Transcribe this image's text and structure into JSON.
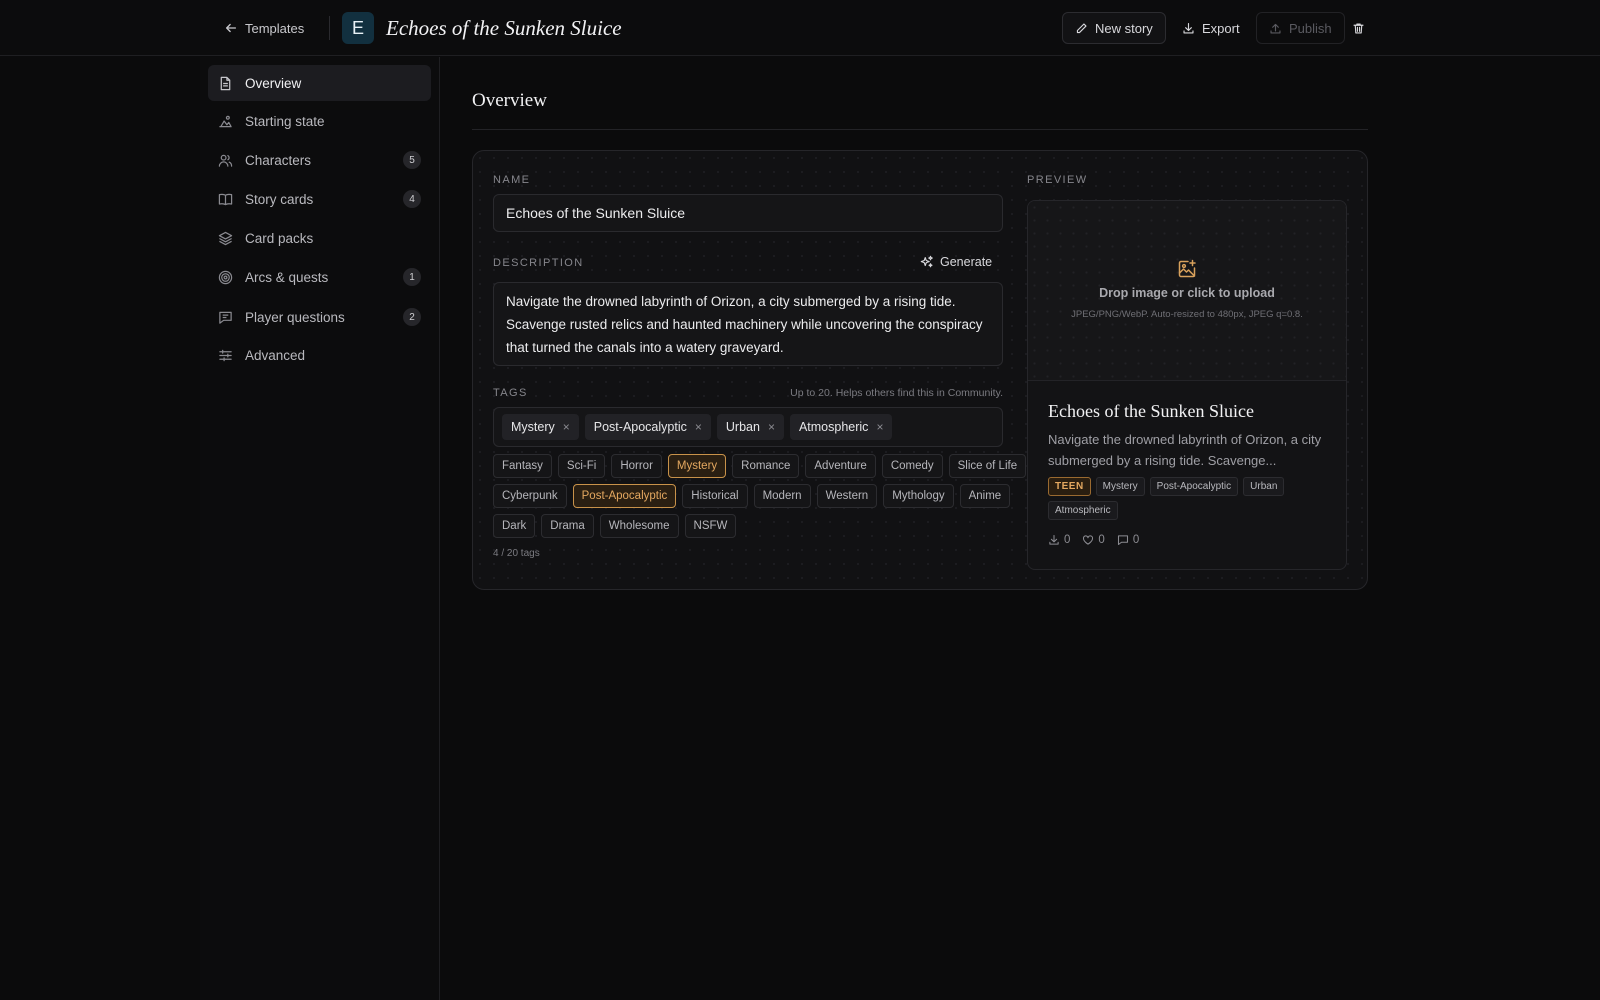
{
  "header": {
    "back_label": "Templates",
    "avatar_letter": "E",
    "story_title": "Echoes of the Sunken Sluice",
    "new_story_label": "New story",
    "export_label": "Export",
    "publish_label": "Publish"
  },
  "sidebar": {
    "items": [
      {
        "label": "Overview",
        "icon": "document-icon",
        "badge": ""
      },
      {
        "label": "Starting state",
        "icon": "landscape-icon",
        "badge": ""
      },
      {
        "label": "Characters",
        "icon": "users-icon",
        "badge": "5"
      },
      {
        "label": "Story cards",
        "icon": "book-icon",
        "badge": "4"
      },
      {
        "label": "Card packs",
        "icon": "layers-icon",
        "badge": ""
      },
      {
        "label": "Arcs & quests",
        "icon": "target-icon",
        "badge": "1"
      },
      {
        "label": "Player questions",
        "icon": "message-icon",
        "badge": "2"
      },
      {
        "label": "Advanced",
        "icon": "sliders-icon",
        "badge": ""
      }
    ]
  },
  "main": {
    "title": "Overview",
    "name_label": "NAME",
    "name_value": "Echoes of the Sunken Sluice",
    "description_label": "DESCRIPTION",
    "generate_label": "Generate",
    "description_value": "Navigate the drowned labyrinth of Orizon, a city submerged by a rising tide. Scavenge rusted relics and haunted machinery while uncovering the conspiracy that turned the canals into a watery graveyard.",
    "tags_label": "TAGS",
    "tags_hint": "Up to 20. Helps others find this in Community.",
    "selected_tags": [
      "Mystery",
      "Post-Apocalyptic",
      "Urban",
      "Atmospheric"
    ],
    "remove_glyph": "×",
    "suggestion_rows": [
      [
        {
          "label": "Fantasy",
          "on": false
        },
        {
          "label": "Sci-Fi",
          "on": false
        },
        {
          "label": "Horror",
          "on": false
        },
        {
          "label": "Mystery",
          "on": true
        },
        {
          "label": "Romance",
          "on": false
        },
        {
          "label": "Adventure",
          "on": false
        },
        {
          "label": "Comedy",
          "on": false
        },
        {
          "label": "Slice of Life",
          "on": false
        }
      ],
      [
        {
          "label": "Cyberpunk",
          "on": false
        },
        {
          "label": "Post-Apocalyptic",
          "on": true
        },
        {
          "label": "Historical",
          "on": false
        },
        {
          "label": "Modern",
          "on": false
        },
        {
          "label": "Western",
          "on": false
        },
        {
          "label": "Mythology",
          "on": false
        },
        {
          "label": "Anime",
          "on": false
        }
      ],
      [
        {
          "label": "Dark",
          "on": false
        },
        {
          "label": "Drama",
          "on": false
        },
        {
          "label": "Wholesome",
          "on": false
        },
        {
          "label": "NSFW",
          "on": false
        }
      ]
    ],
    "tag_count": "4 / 20 tags"
  },
  "preview": {
    "label": "PREVIEW",
    "upload_title": "Drop image or click to upload",
    "upload_sub": "JPEG/PNG/WebP. Auto-resized to 480px, JPEG q=0.8.",
    "title": "Echoes of the Sunken Sluice",
    "description": "Navigate the drowned labyrinth of Orizon, a city submerged by a rising tide. Scavenge...",
    "rating": "TEEN",
    "tags": [
      "Mystery",
      "Post-Apocalyptic",
      "Urban",
      "Atmospheric"
    ],
    "downloads": "0",
    "likes": "0",
    "comments": "0"
  },
  "colors": {
    "accent": "#e4a860",
    "background": "#0b0b0c",
    "panel": "#111113",
    "avatar": "#12303f"
  }
}
